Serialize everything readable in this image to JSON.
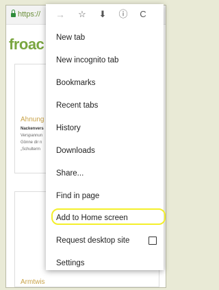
{
  "browser": {
    "url_text": "https://"
  },
  "page": {
    "logo": "froac",
    "card1": {
      "title": "Ahnung",
      "lines": [
        "Nackenvers",
        "Verspannun",
        "Gönne dir n",
        "„Schulterm"
      ]
    },
    "card2": {
      "title": "Armtwis"
    }
  },
  "toolbar": {
    "forward": "→",
    "bookmark": "☆",
    "download": "⬇",
    "info": "ⓘ",
    "reload": "C"
  },
  "menu": {
    "items": [
      "New tab",
      "New incognito tab",
      "Bookmarks",
      "Recent tabs",
      "History",
      "Downloads",
      "Share...",
      "Find in page",
      "Add to Home screen",
      "Request desktop site",
      "Settings"
    ]
  },
  "icons": [
    "lock-icon",
    "forward-icon",
    "star-icon",
    "download-icon",
    "info-icon",
    "reload-icon"
  ],
  "colors": {
    "accent_green": "#7aa640",
    "highlight": "#f4ef2a",
    "secure_green": "#2e8b3a"
  }
}
